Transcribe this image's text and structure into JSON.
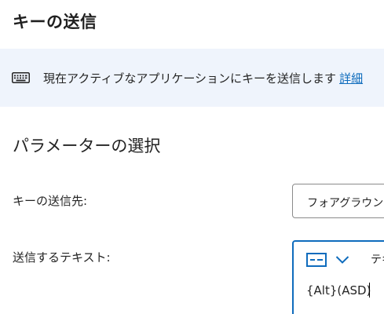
{
  "page": {
    "title": "キーの送信"
  },
  "info": {
    "icon": "keyboard-icon",
    "text": "現在アクティブなアプリケーションにキーを送信します",
    "link_label": "詳細"
  },
  "parameters": {
    "section_title": "パラメーターの選択",
    "send_to": {
      "label": "キーの送信先:",
      "value": "フォアグラウンド"
    },
    "text_to_send": {
      "label": "送信するテキスト:",
      "toolbar_icon": "text-mode-icon",
      "toolbar_chevron": "chevron-down-icon",
      "tab_label": "テキ",
      "value": "{Alt}(ASD)"
    }
  },
  "colors": {
    "accent": "#0f6cbd",
    "info_background": "#eff4fc"
  }
}
